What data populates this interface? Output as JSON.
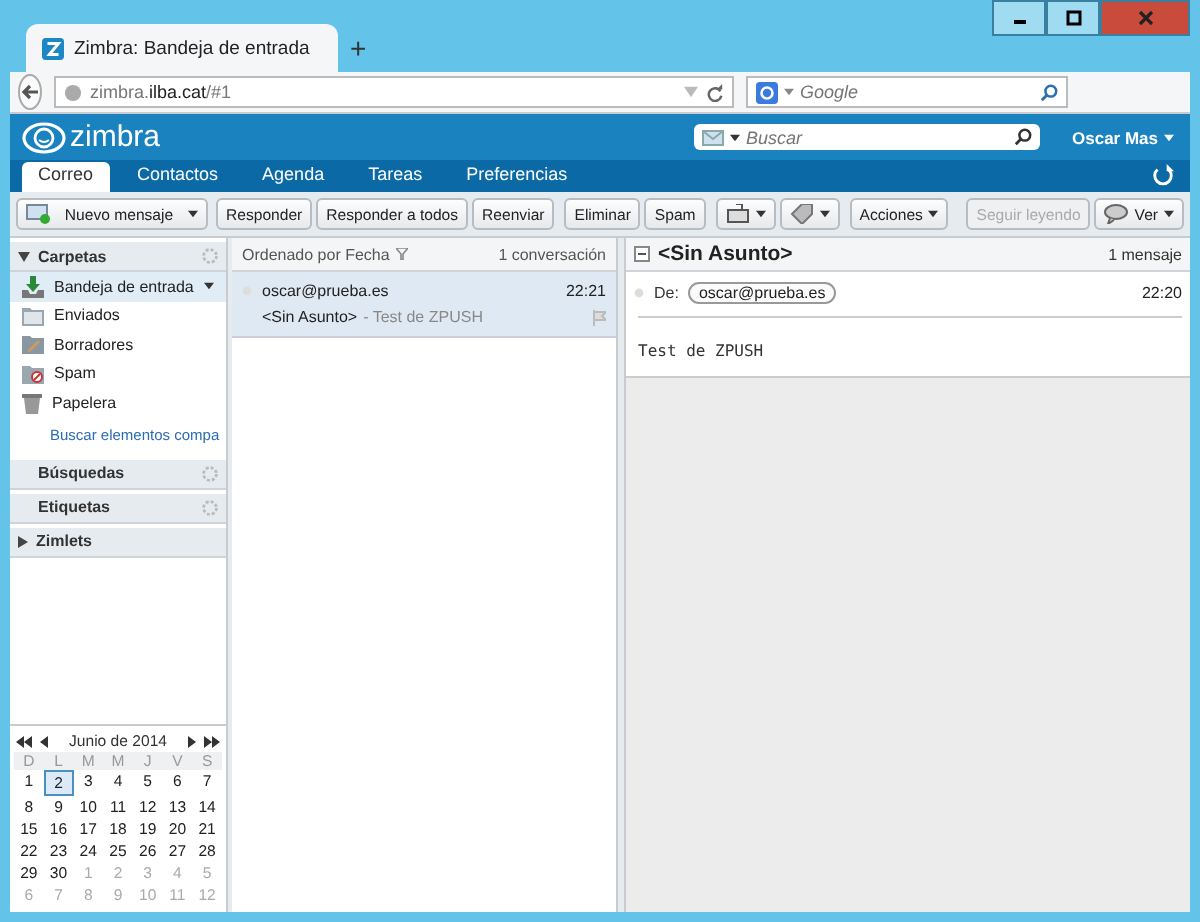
{
  "browser": {
    "tab_title": "Zimbra: Bandeja de entrada",
    "new_tab": "+",
    "url_host": "zimbra.",
    "url_domain": "ilba.cat",
    "url_path": "/#1",
    "search_placeholder": "Google"
  },
  "app": {
    "logo": "zimbra",
    "search_placeholder": "Buscar",
    "user": "Oscar Mas"
  },
  "tabs": [
    {
      "label": "Correo",
      "selected": true
    },
    {
      "label": "Contactos",
      "selected": false
    },
    {
      "label": "Agenda",
      "selected": false
    },
    {
      "label": "Tareas",
      "selected": false
    },
    {
      "label": "Preferencias",
      "selected": false
    }
  ],
  "toolbar": {
    "left": [
      {
        "kind": "new",
        "label": "Nuevo mensaje"
      },
      {
        "kind": "text",
        "label": "Responder",
        "disabled": false
      },
      {
        "kind": "text",
        "label": "Responder a todos",
        "disabled": false
      },
      {
        "kind": "text",
        "label": "Reenviar",
        "disabled": false
      },
      {
        "kind": "text",
        "label": "Eliminar",
        "disabled": false
      },
      {
        "kind": "text",
        "label": "Spam",
        "disabled": false
      },
      {
        "kind": "move"
      },
      {
        "kind": "tag"
      },
      {
        "kind": "menu",
        "label": "Acciones"
      }
    ],
    "right": [
      {
        "kind": "text",
        "label": "Seguir leyendo",
        "disabled": true
      },
      {
        "kind": "view",
        "label": "Ver"
      }
    ]
  },
  "sidebar": {
    "sections": [
      {
        "title": "Carpetas",
        "expanded": true,
        "gear": true,
        "items": [
          {
            "kind": "inbox",
            "label": "Bandeja de entrada",
            "selected": true
          },
          {
            "kind": "sent",
            "label": "Enviados",
            "selected": false
          },
          {
            "kind": "drafts",
            "label": "Borradores",
            "selected": false
          },
          {
            "kind": "spam",
            "label": "Spam",
            "selected": false
          },
          {
            "kind": "trash",
            "label": "Papelera",
            "selected": false
          }
        ],
        "link": "Buscar elementos compa"
      },
      {
        "title": "Búsquedas",
        "gear": true
      },
      {
        "title": "Etiquetas",
        "gear": true
      },
      {
        "title": "Zimlets",
        "expanded": false
      }
    ]
  },
  "calendar": {
    "month": "Junio de 2014",
    "weekdays": [
      "D",
      "L",
      "M",
      "M",
      "J",
      "V",
      "S"
    ],
    "weeks": [
      [
        {
          "d": "1",
          "selected": false,
          "outside": false
        },
        {
          "d": "2",
          "selected": true,
          "outside": false
        },
        {
          "d": "3",
          "selected": false,
          "outside": false
        },
        {
          "d": "4",
          "selected": false,
          "outside": false
        },
        {
          "d": "5",
          "selected": false,
          "outside": false
        },
        {
          "d": "6",
          "selected": false,
          "outside": false
        },
        {
          "d": "7",
          "selected": false,
          "outside": false
        }
      ],
      [
        {
          "d": "8",
          "selected": false,
          "outside": false
        },
        {
          "d": "9",
          "selected": false,
          "outside": false
        },
        {
          "d": "10",
          "selected": false,
          "outside": false
        },
        {
          "d": "11",
          "selected": false,
          "outside": false
        },
        {
          "d": "12",
          "selected": false,
          "outside": false
        },
        {
          "d": "13",
          "selected": false,
          "outside": false
        },
        {
          "d": "14",
          "selected": false,
          "outside": false
        }
      ],
      [
        {
          "d": "15",
          "selected": false,
          "outside": false
        },
        {
          "d": "16",
          "selected": false,
          "outside": false
        },
        {
          "d": "17",
          "selected": false,
          "outside": false
        },
        {
          "d": "18",
          "selected": false,
          "outside": false
        },
        {
          "d": "19",
          "selected": false,
          "outside": false
        },
        {
          "d": "20",
          "selected": false,
          "outside": false
        },
        {
          "d": "21",
          "selected": false,
          "outside": false
        }
      ],
      [
        {
          "d": "22",
          "selected": false,
          "outside": false
        },
        {
          "d": "23",
          "selected": false,
          "outside": false
        },
        {
          "d": "24",
          "selected": false,
          "outside": false
        },
        {
          "d": "25",
          "selected": false,
          "outside": false
        },
        {
          "d": "26",
          "selected": false,
          "outside": false
        },
        {
          "d": "27",
          "selected": false,
          "outside": false
        },
        {
          "d": "28",
          "selected": false,
          "outside": false
        }
      ],
      [
        {
          "d": "29",
          "selected": false,
          "outside": false
        },
        {
          "d": "30",
          "selected": false,
          "outside": false
        },
        {
          "d": "1",
          "selected": false,
          "outside": true
        },
        {
          "d": "2",
          "selected": false,
          "outside": true
        },
        {
          "d": "3",
          "selected": false,
          "outside": true
        },
        {
          "d": "4",
          "selected": false,
          "outside": true
        },
        {
          "d": "5",
          "selected": false,
          "outside": true
        }
      ],
      [
        {
          "d": "6",
          "selected": false,
          "outside": true
        },
        {
          "d": "7",
          "selected": false,
          "outside": true
        },
        {
          "d": "8",
          "selected": false,
          "outside": true
        },
        {
          "d": "9",
          "selected": false,
          "outside": true
        },
        {
          "d": "10",
          "selected": false,
          "outside": true
        },
        {
          "d": "11",
          "selected": false,
          "outside": true
        },
        {
          "d": "12",
          "selected": false,
          "outside": true
        }
      ]
    ]
  },
  "message_list": {
    "sort": "Ordenado por Fecha",
    "count": "1 conversación",
    "messages": [
      {
        "from": "oscar@prueba.es",
        "time": "22:21",
        "subject": "<Sin Asunto>",
        "preview": "- Test de ZPUSH",
        "selected": true
      }
    ]
  },
  "reading_pane": {
    "subject": "<Sin Asunto>",
    "count": "1 mensaje",
    "from_label": "De:",
    "from": "oscar@prueba.es",
    "time": "22:20",
    "body": "Test de ZPUSH"
  }
}
